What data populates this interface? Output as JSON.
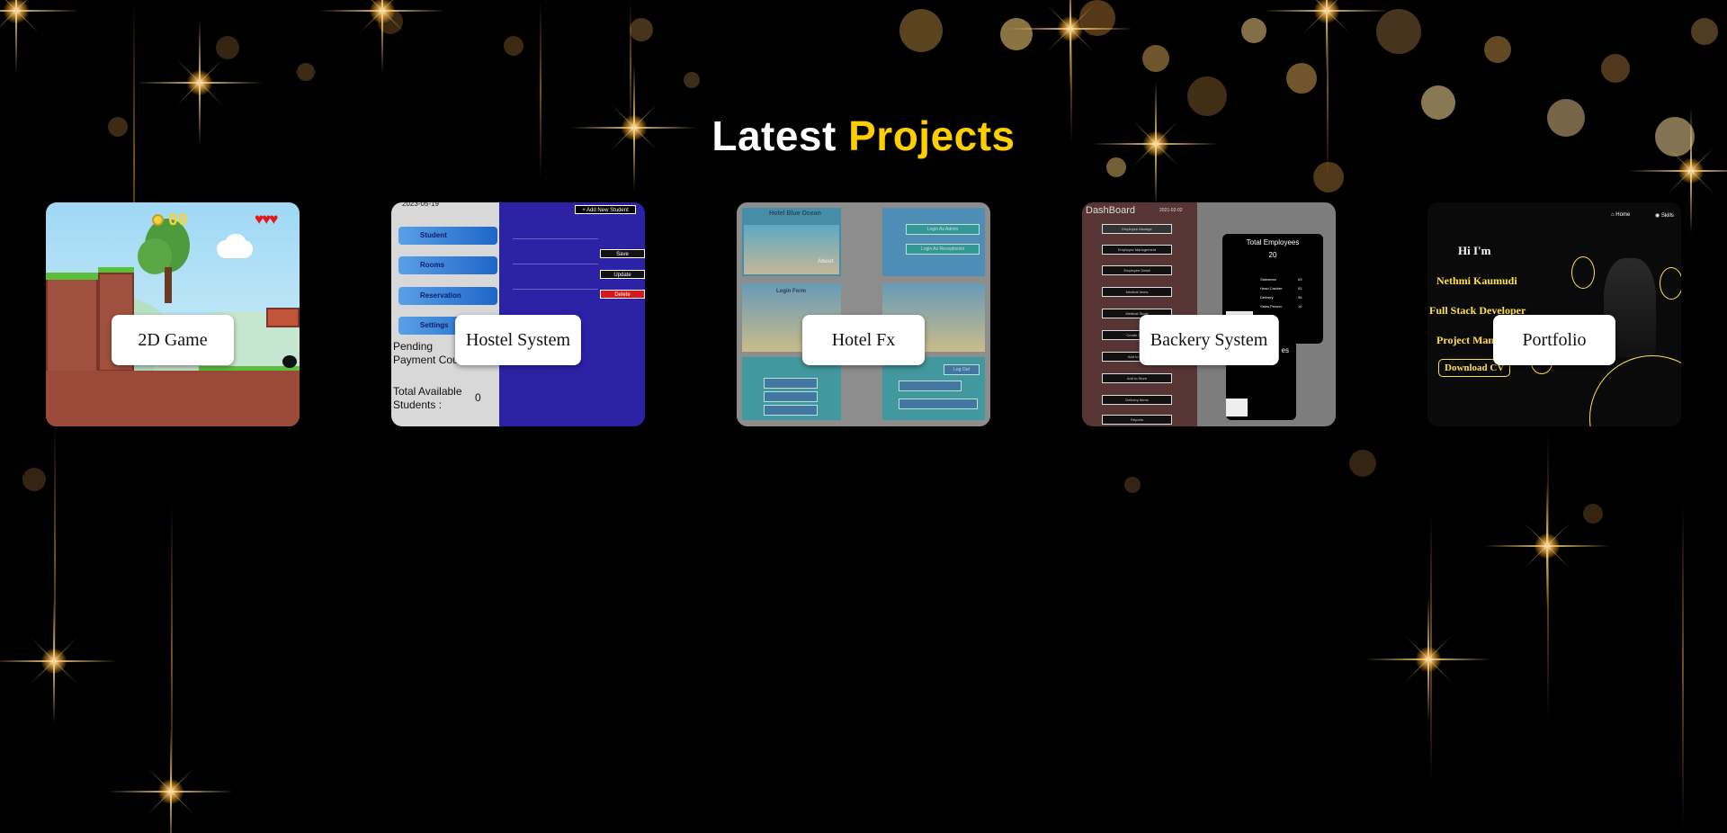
{
  "section": {
    "title_main": "Latest",
    "title_accent": "Projects"
  },
  "projects": [
    {
      "label": "2D Game",
      "preview": {
        "hud_count": "00",
        "hearts": "♥♥♥"
      }
    },
    {
      "label": "Hostel System",
      "preview": {
        "date": "2023-05-19",
        "add_button": "+ Add New Student",
        "nav": [
          "Student",
          "Rooms",
          "Reservation",
          "Settings"
        ],
        "pending_label": "Pending Payment Count :",
        "total_label": "Total Available Students :",
        "total_value": "0",
        "buttons": [
          "Save",
          "Update",
          "Delete"
        ]
      }
    },
    {
      "label": "Hotel Fx",
      "preview": {
        "brand": "Hotel Blue Ocean",
        "about": "About",
        "login_admin": "Login As Admin",
        "login_reception": "Login As Receptionist",
        "login_form": "Login Form",
        "logout": "Log Out"
      }
    },
    {
      "label": "Backery System",
      "preview": {
        "heading": "DashBoard",
        "date": "2021-02-02",
        "menu": [
          "Employee Manage",
          "Employee Management",
          "Employee Detail",
          "Medical Items",
          "Medical Stock",
          "Create Order",
          "Add to Cart",
          "Add to Store",
          "Delivery Items",
          "Reports"
        ],
        "panel_title": "Total Employees",
        "panel_value": "20",
        "stats": [
          {
            "k": "Salesman",
            "v": "03"
          },
          {
            "k": "Head Cashier",
            "v": "02"
          },
          {
            "k": "Delivery",
            "v": "05"
          },
          {
            "k": "Sales Person",
            "v": "10"
          }
        ],
        "panel2_title": "es"
      }
    },
    {
      "label": "Portfolio",
      "preview": {
        "nav": [
          "Home",
          "Skills"
        ],
        "greeting": "Hi I'm",
        "name": "Nethmi Kaumudi",
        "role1": "Full Stack Developer",
        "role2": "Project Manager",
        "cta": "Download CV"
      }
    }
  ],
  "colors": {
    "accent": "#ffce00",
    "background": "#000000",
    "label_bg": "#ffffff"
  }
}
